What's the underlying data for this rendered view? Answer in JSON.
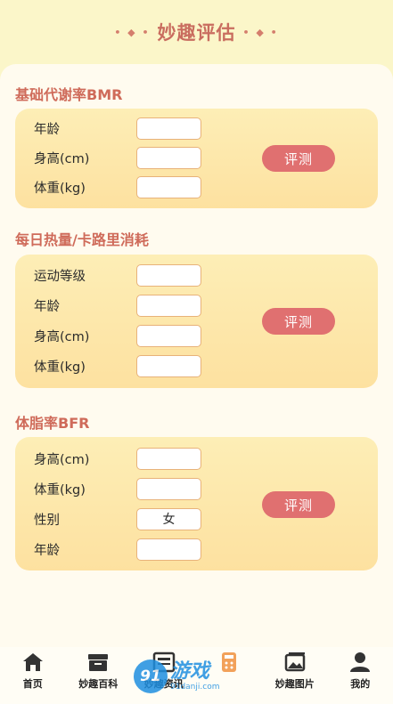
{
  "header": {
    "title": "妙趣评估",
    "deco_left": "• ◆ •",
    "deco_right": "• ◆ •"
  },
  "sections": [
    {
      "title": "基础代谢率BMR",
      "fields": [
        {
          "label": "年龄",
          "value": ""
        },
        {
          "label": "身高(cm)",
          "value": ""
        },
        {
          "label": "体重(kg)",
          "value": ""
        }
      ],
      "button": "评测"
    },
    {
      "title": "每日热量/卡路里消耗",
      "fields": [
        {
          "label": "运动等级",
          "value": ""
        },
        {
          "label": "年龄",
          "value": ""
        },
        {
          "label": "身高(cm)",
          "value": ""
        },
        {
          "label": "体重(kg)",
          "value": ""
        }
      ],
      "button": "评测"
    },
    {
      "title": "体脂率BFR",
      "fields": [
        {
          "label": "身高(cm)",
          "value": ""
        },
        {
          "label": "体重(kg)",
          "value": ""
        },
        {
          "label": "性别",
          "value": "女"
        },
        {
          "label": "年龄",
          "value": ""
        }
      ],
      "button": "评测"
    }
  ],
  "tabbar": [
    {
      "label": "首页",
      "icon": "home-icon"
    },
    {
      "label": "妙趣百科",
      "icon": "box-icon"
    },
    {
      "label": "妙趣资讯",
      "icon": "news-icon"
    },
    {
      "label": "",
      "icon": "calculator-icon"
    },
    {
      "label": "妙趣图片",
      "icon": "image-icon"
    },
    {
      "label": "我的",
      "icon": "user-icon"
    }
  ],
  "watermark": {
    "logo": "91",
    "main": "游戏",
    "sub": "91danji.com"
  },
  "colors": {
    "accent": "#e07070",
    "title": "#cf6b5a",
    "card": "#fde6a8"
  }
}
